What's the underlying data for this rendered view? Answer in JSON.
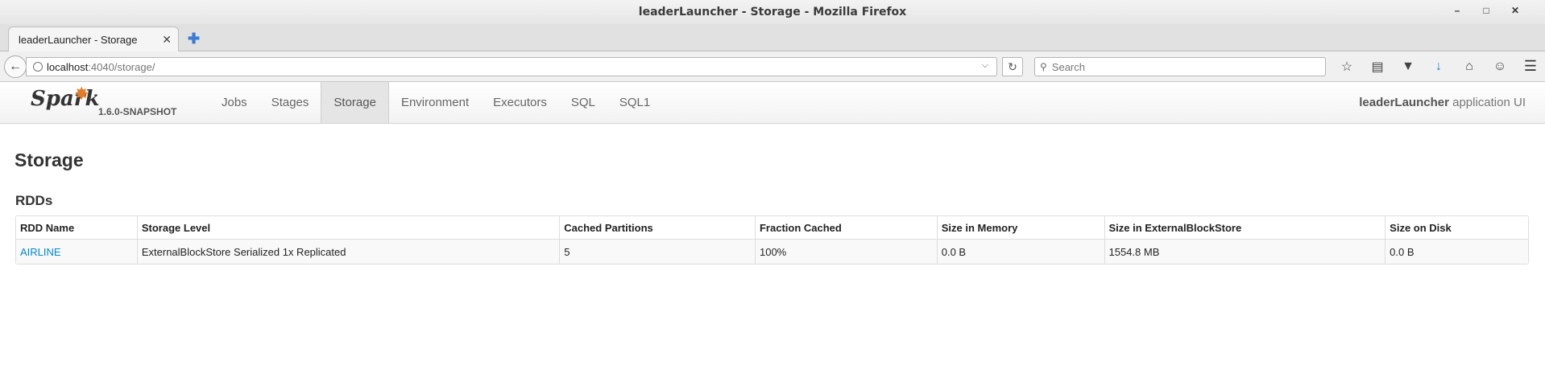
{
  "window": {
    "title": "leaderLauncher - Storage - Mozilla Firefox",
    "controls": [
      "minimize",
      "maximize",
      "close"
    ]
  },
  "browser": {
    "tab_title": "leaderLauncher - Storage",
    "url_host": "localhost",
    "url_path": ":4040/storage/",
    "search_placeholder": "Search"
  },
  "spark": {
    "logo_text": "Spark",
    "version": "1.6.0-SNAPSHOT",
    "nav": [
      {
        "label": "Jobs",
        "active": false
      },
      {
        "label": "Stages",
        "active": false
      },
      {
        "label": "Storage",
        "active": true
      },
      {
        "label": "Environment",
        "active": false
      },
      {
        "label": "Executors",
        "active": false
      },
      {
        "label": "SQL",
        "active": false
      },
      {
        "label": "SQL1",
        "active": false
      }
    ],
    "app_name": "leaderLauncher",
    "app_suffix": "application UI"
  },
  "page": {
    "title": "Storage",
    "section": "RDDs",
    "table": {
      "headers": [
        "RDD Name",
        "Storage Level",
        "Cached Partitions",
        "Fraction Cached",
        "Size in Memory",
        "Size in ExternalBlockStore",
        "Size on Disk"
      ],
      "rows": [
        [
          "AIRLINE",
          "ExternalBlockStore Serialized 1x Replicated",
          "5",
          "100%",
          "0.0 B",
          "1554.8 MB",
          "0.0 B"
        ]
      ]
    }
  },
  "colors": {
    "link": "#0088cc",
    "spark_orange": "#e27c28"
  }
}
